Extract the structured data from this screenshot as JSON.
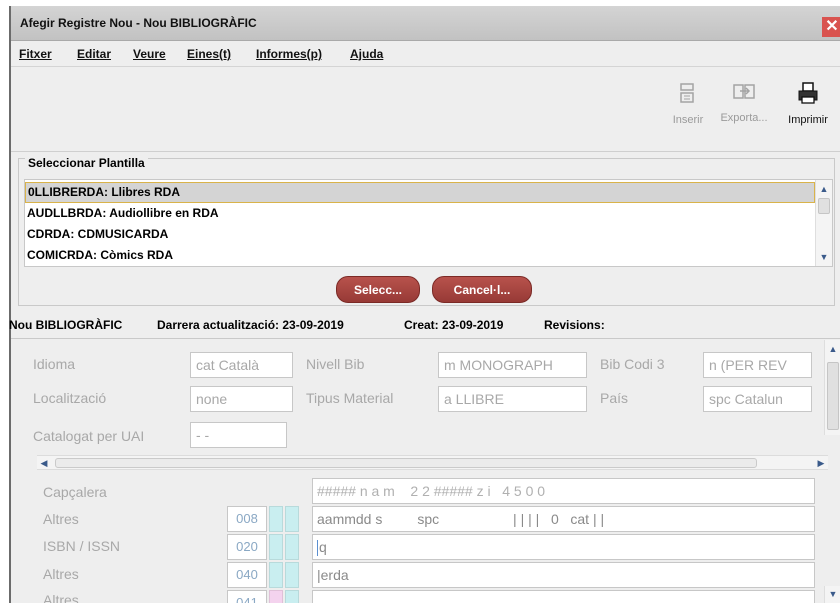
{
  "window": {
    "title": "Afegir Registre Nou - Nou BIBLIOGRÀFIC",
    "close_label": "✕"
  },
  "menu": {
    "fitxer": "Fitxer",
    "editar": "Editar",
    "veure": "Veure",
    "eines": "Eines(t)",
    "informes": "Informes(p)",
    "ajuda": "Ajuda"
  },
  "toolbar": {
    "inserir": "Inserir",
    "exporta": "Exporta...",
    "imprimir": "Imprimir"
  },
  "plantilla": {
    "legend": "Seleccionar Plantilla",
    "items": [
      "0LLIBRERDA: Llibres RDA",
      "AUDLLBRDA: Audiollibre en RDA",
      "CDRDA: CDMUSICARDA",
      "COMICRDA: Còmics RDA"
    ],
    "selected_index": 0,
    "select_button": "Selecc...",
    "cancel_button": "Cancel·l..."
  },
  "info": {
    "record_type": "Nou BIBLIOGRÀFIC",
    "last_update": "Darrera actualització: 23-09-2019",
    "created": "Creat: 23-09-2019",
    "revisions": "Revisions:"
  },
  "fixed_fields": {
    "idioma_label": "Idioma",
    "idioma_value": "cat Català",
    "nivell_label": "Nivell Bib",
    "nivell_value": "m MONOGRAPH",
    "bibcodi_label": "Bib Codi 3",
    "bibcodi_value": "n (PER REV",
    "localitzacio_label": "Localització",
    "localitzacio_value": "none",
    "tipus_label": "Tipus Material",
    "tipus_value": "a LLIBRE",
    "pais_label": "País",
    "pais_value": "spc Catalun",
    "catalogat_label": "Catalogat per UAI",
    "catalogat_value": "- -"
  },
  "marc_fields": [
    {
      "label": "Capçalera",
      "tag": "",
      "value": "##### n a m    2 2 ##### z i   4 5 0 0"
    },
    {
      "label": "Altres",
      "tag": "008",
      "value": "aammdd s         spc                   | | | |   0   cat | |"
    },
    {
      "label": "ISBN / ISSN",
      "tag": "020",
      "value": "|q"
    },
    {
      "label": "Altres",
      "tag": "040",
      "value": "|erda"
    },
    {
      "label": "Altres",
      "tag": "041",
      "value": ""
    }
  ]
}
